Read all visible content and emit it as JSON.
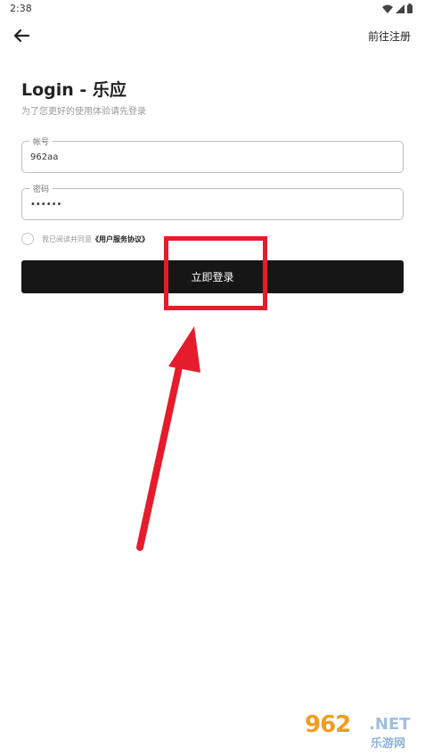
{
  "status_bar": {
    "time": "2:38"
  },
  "header": {
    "register_label": "前往注册"
  },
  "page": {
    "title": "Login - 乐应",
    "subtitle": "为了您更好的使用体验请先登录"
  },
  "form": {
    "account": {
      "label": "帐号",
      "value": "962aa"
    },
    "password": {
      "label": "密码",
      "value": "••••••"
    },
    "agreement": {
      "prefix": "我已阅读并同意",
      "link": "《用户服务协议》"
    },
    "submit_label": "立即登录"
  },
  "watermark": {
    "number": "962",
    "net": ".NET",
    "cn": "乐游网"
  },
  "colors": {
    "accent_red": "#e51c2c",
    "button_bg": "#161616"
  }
}
